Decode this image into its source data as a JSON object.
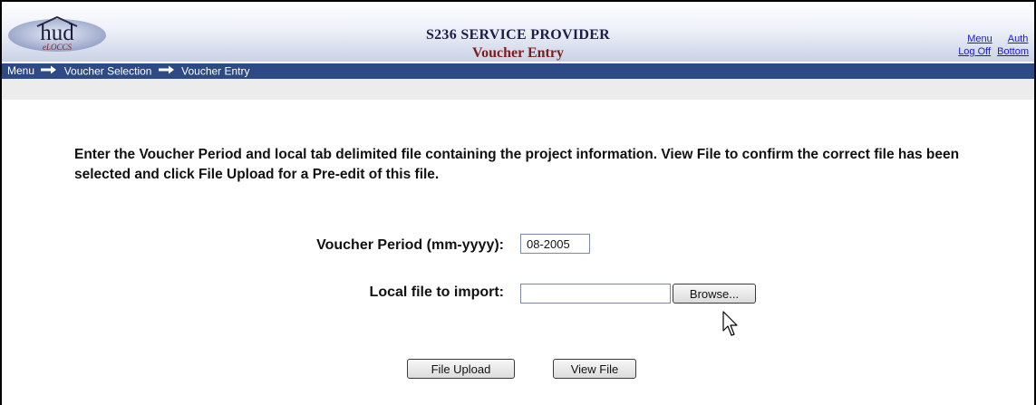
{
  "header": {
    "logo_text": "hud",
    "logo_subtext": "eLOCCS",
    "title": "S236 SERVICE PROVIDER",
    "subtitle": "Voucher Entry",
    "links_row1": [
      "Menu",
      "Auth"
    ],
    "links_row2": [
      "Log Off",
      "Bottom"
    ]
  },
  "breadcrumb": {
    "items": [
      "Menu",
      "Voucher Selection",
      "Voucher Entry"
    ]
  },
  "main": {
    "instructions": "Enter the Voucher Period and local tab delimited file containing the project information.  View File to confirm the correct file has been selected and click File Upload for a Pre-edit of this file.",
    "voucher_period_label": "Voucher Period (mm-yyyy):",
    "voucher_period_value": "08-2005",
    "local_file_label": "Local file to import:",
    "local_file_value": "",
    "browse_label": "Browse...",
    "upload_label": "File Upload",
    "view_label": "View File"
  },
  "colors": {
    "navbar": "#2e4a86",
    "title": "#1d1d4a",
    "subtitle": "#7a1f1f",
    "link": "#1a1ad0"
  },
  "icons": {
    "logo": "hud-eloccs-logo",
    "breadcrumb_separator": "right-arrow-icon",
    "cursor": "mouse-pointer-icon"
  }
}
